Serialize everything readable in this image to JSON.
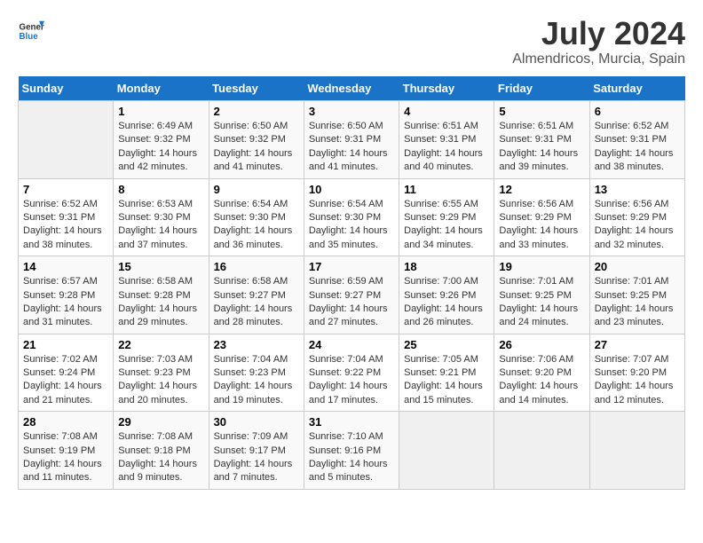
{
  "header": {
    "logo_line1": "General",
    "logo_line2": "Blue",
    "month_title": "July 2024",
    "location": "Almendricos, Murcia, Spain"
  },
  "days_of_week": [
    "Sunday",
    "Monday",
    "Tuesday",
    "Wednesday",
    "Thursday",
    "Friday",
    "Saturday"
  ],
  "weeks": [
    [
      {
        "day": "",
        "info": ""
      },
      {
        "day": "1",
        "info": "Sunrise: 6:49 AM\nSunset: 9:32 PM\nDaylight: 14 hours\nand 42 minutes."
      },
      {
        "day": "2",
        "info": "Sunrise: 6:50 AM\nSunset: 9:32 PM\nDaylight: 14 hours\nand 41 minutes."
      },
      {
        "day": "3",
        "info": "Sunrise: 6:50 AM\nSunset: 9:31 PM\nDaylight: 14 hours\nand 41 minutes."
      },
      {
        "day": "4",
        "info": "Sunrise: 6:51 AM\nSunset: 9:31 PM\nDaylight: 14 hours\nand 40 minutes."
      },
      {
        "day": "5",
        "info": "Sunrise: 6:51 AM\nSunset: 9:31 PM\nDaylight: 14 hours\nand 39 minutes."
      },
      {
        "day": "6",
        "info": "Sunrise: 6:52 AM\nSunset: 9:31 PM\nDaylight: 14 hours\nand 38 minutes."
      }
    ],
    [
      {
        "day": "7",
        "info": "Sunrise: 6:52 AM\nSunset: 9:31 PM\nDaylight: 14 hours\nand 38 minutes."
      },
      {
        "day": "8",
        "info": "Sunrise: 6:53 AM\nSunset: 9:30 PM\nDaylight: 14 hours\nand 37 minutes."
      },
      {
        "day": "9",
        "info": "Sunrise: 6:54 AM\nSunset: 9:30 PM\nDaylight: 14 hours\nand 36 minutes."
      },
      {
        "day": "10",
        "info": "Sunrise: 6:54 AM\nSunset: 9:30 PM\nDaylight: 14 hours\nand 35 minutes."
      },
      {
        "day": "11",
        "info": "Sunrise: 6:55 AM\nSunset: 9:29 PM\nDaylight: 14 hours\nand 34 minutes."
      },
      {
        "day": "12",
        "info": "Sunrise: 6:56 AM\nSunset: 9:29 PM\nDaylight: 14 hours\nand 33 minutes."
      },
      {
        "day": "13",
        "info": "Sunrise: 6:56 AM\nSunset: 9:29 PM\nDaylight: 14 hours\nand 32 minutes."
      }
    ],
    [
      {
        "day": "14",
        "info": "Sunrise: 6:57 AM\nSunset: 9:28 PM\nDaylight: 14 hours\nand 31 minutes."
      },
      {
        "day": "15",
        "info": "Sunrise: 6:58 AM\nSunset: 9:28 PM\nDaylight: 14 hours\nand 29 minutes."
      },
      {
        "day": "16",
        "info": "Sunrise: 6:58 AM\nSunset: 9:27 PM\nDaylight: 14 hours\nand 28 minutes."
      },
      {
        "day": "17",
        "info": "Sunrise: 6:59 AM\nSunset: 9:27 PM\nDaylight: 14 hours\nand 27 minutes."
      },
      {
        "day": "18",
        "info": "Sunrise: 7:00 AM\nSunset: 9:26 PM\nDaylight: 14 hours\nand 26 minutes."
      },
      {
        "day": "19",
        "info": "Sunrise: 7:01 AM\nSunset: 9:25 PM\nDaylight: 14 hours\nand 24 minutes."
      },
      {
        "day": "20",
        "info": "Sunrise: 7:01 AM\nSunset: 9:25 PM\nDaylight: 14 hours\nand 23 minutes."
      }
    ],
    [
      {
        "day": "21",
        "info": "Sunrise: 7:02 AM\nSunset: 9:24 PM\nDaylight: 14 hours\nand 21 minutes."
      },
      {
        "day": "22",
        "info": "Sunrise: 7:03 AM\nSunset: 9:23 PM\nDaylight: 14 hours\nand 20 minutes."
      },
      {
        "day": "23",
        "info": "Sunrise: 7:04 AM\nSunset: 9:23 PM\nDaylight: 14 hours\nand 19 minutes."
      },
      {
        "day": "24",
        "info": "Sunrise: 7:04 AM\nSunset: 9:22 PM\nDaylight: 14 hours\nand 17 minutes."
      },
      {
        "day": "25",
        "info": "Sunrise: 7:05 AM\nSunset: 9:21 PM\nDaylight: 14 hours\nand 15 minutes."
      },
      {
        "day": "26",
        "info": "Sunrise: 7:06 AM\nSunset: 9:20 PM\nDaylight: 14 hours\nand 14 minutes."
      },
      {
        "day": "27",
        "info": "Sunrise: 7:07 AM\nSunset: 9:20 PM\nDaylight: 14 hours\nand 12 minutes."
      }
    ],
    [
      {
        "day": "28",
        "info": "Sunrise: 7:08 AM\nSunset: 9:19 PM\nDaylight: 14 hours\nand 11 minutes."
      },
      {
        "day": "29",
        "info": "Sunrise: 7:08 AM\nSunset: 9:18 PM\nDaylight: 14 hours\nand 9 minutes."
      },
      {
        "day": "30",
        "info": "Sunrise: 7:09 AM\nSunset: 9:17 PM\nDaylight: 14 hours\nand 7 minutes."
      },
      {
        "day": "31",
        "info": "Sunrise: 7:10 AM\nSunset: 9:16 PM\nDaylight: 14 hours\nand 5 minutes."
      },
      {
        "day": "",
        "info": ""
      },
      {
        "day": "",
        "info": ""
      },
      {
        "day": "",
        "info": ""
      }
    ]
  ]
}
